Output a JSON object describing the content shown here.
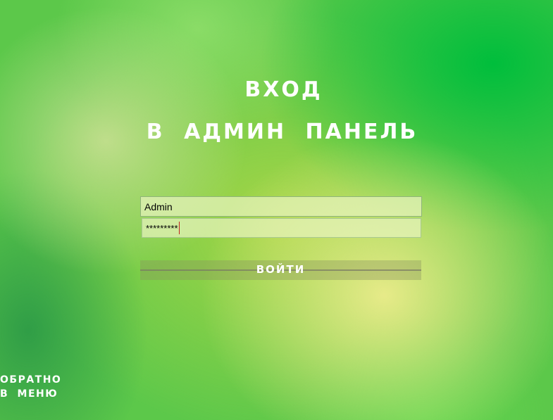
{
  "header": {
    "title_line1": "ВХОД",
    "title_line2": "В АДМИН ПАНЕЛЬ"
  },
  "form": {
    "username_value": "Admin",
    "password_value": "*********",
    "login_label": "ВОЙТИ"
  },
  "back_link": {
    "line1": "ОБРАТНО",
    "line2": "В МЕНЮ"
  }
}
